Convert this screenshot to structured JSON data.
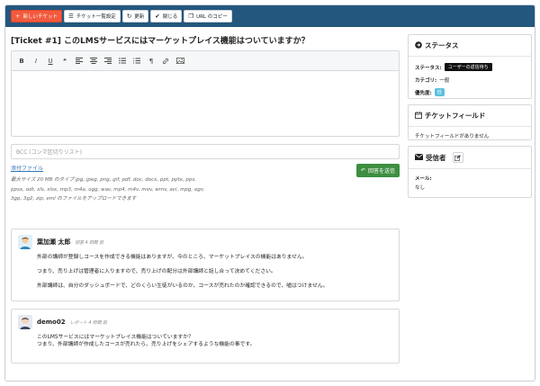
{
  "toolbar": {
    "new_ticket": "新しいチケット",
    "ticket_list_settings": "チケット一覧設定",
    "refresh": "更新",
    "close": "閉じる",
    "copy_url": "URL のコピー"
  },
  "ticket": {
    "title": "[Ticket #1] このLMSサービスにはマーケットプレイス機能はついていますか？"
  },
  "editor": {
    "tools": [
      "bold-icon",
      "italic-icon",
      "underline-icon",
      "quote-icon",
      "align-left-icon",
      "align-center-icon",
      "align-right-icon",
      "bullet-list-icon",
      "numbered-list-icon",
      "paragraph-icon",
      "link-icon",
      "image-icon"
    ]
  },
  "bcc": {
    "placeholder": "BCC (コンマ区切りリスト)"
  },
  "attachment": {
    "link": "添付ファイル",
    "help": "最大サイズ 20 MB のタイプ jpg, jpeg, png, gif, pdf, doc, docx, ppt, pptx, pps, ppsx, odt, xls, xlsx, mp3, m4a, ogg, wav, mp4, m4v, mov, wmv, avi, mpg, ogv, 3gp, 3g2, zip, eml のファイルをアップロードできます",
    "send_reply": "回答を送信"
  },
  "comments": [
    {
      "author": "葉加瀬 太郎",
      "meta": "回答 4 時間 前",
      "lines": [
        "外部の講師が登録しコースを作成できる機能はありますが、今のところ、マーケットプレイスの機能はありません。",
        "つまり、売り上げは管理者に入りますので、売り上げの配分は外部講師と話し合って決めてください。",
        "外部講師は、自分のダッシュボードで、どのくらい生徒がいるのか、コースが売れたのか確認できるので、嘘はつけません。"
      ]
    },
    {
      "author": "demo02",
      "meta": "レポート 4 時間 前",
      "lines": [
        "このLMSサービスにはマーケットプレイス機能はついていますか？",
        "つまり、外部講師が作成したコースが売れたら、売り上げをシェアするような機能の事です。"
      ]
    }
  ],
  "sidebar": {
    "status": {
      "heading": "ステータス",
      "status_label": "ステータス:",
      "status_value": "ユーザーの返信待ち",
      "category_label": "カテゴリ:",
      "category_value": "一般",
      "priority_label": "優先度:",
      "priority_value": "低"
    },
    "fields": {
      "heading": "チケットフィールド",
      "empty": "チケットフィールドがありません"
    },
    "recipients": {
      "heading": "受信者",
      "email_label": "メール:",
      "email_value": "なし"
    }
  },
  "colors": {
    "topbar": "#24577e",
    "primary": "#f35a3d",
    "success": "#3e8e41",
    "info": "#5bc0de"
  }
}
